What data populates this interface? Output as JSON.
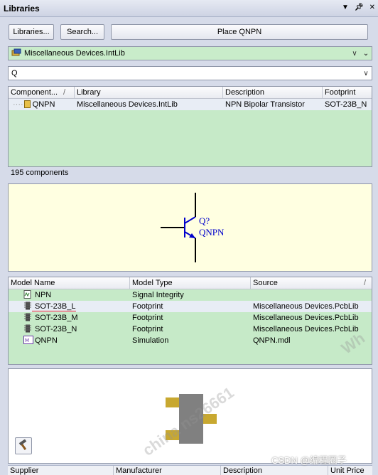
{
  "window": {
    "title": "Libraries"
  },
  "toolbar": {
    "libraries_button": "Libraries...",
    "search_button": "Search...",
    "place_button": "Place QNPN"
  },
  "library_select": {
    "value": "Miscellaneous Devices.IntLib"
  },
  "filter": {
    "value": "Q"
  },
  "components_grid": {
    "headers": [
      "Component...",
      "Library",
      "Description",
      "Footprint"
    ],
    "rows": [
      {
        "name": "QNPN",
        "library": "Miscellaneous Devices.IntLib",
        "description": "NPN Bipolar Transistor",
        "footprint": "SOT-23B_N"
      }
    ],
    "count_label": "195 components"
  },
  "schematic_preview": {
    "designator": "Q?",
    "comment": "QNPN"
  },
  "models_grid": {
    "headers": [
      "Model Name",
      "Model Type",
      "Source"
    ],
    "rows": [
      {
        "name": "NPN",
        "type": "Signal Integrity",
        "source": "",
        "icon": "signal-integrity-icon"
      },
      {
        "name": "SOT-23B_L",
        "type": "Footprint",
        "source": "Miscellaneous Devices.PcbLib",
        "icon": "footprint-icon"
      },
      {
        "name": "SOT-23B_M",
        "type": "Footprint",
        "source": "Miscellaneous Devices.PcbLib",
        "icon": "footprint-icon"
      },
      {
        "name": "SOT-23B_N",
        "type": "Footprint",
        "source": "Miscellaneous Devices.PcbLib",
        "icon": "footprint-icon"
      },
      {
        "name": "QNPN",
        "type": "Simulation",
        "source": "QNPN.mdl",
        "icon": "simulation-icon"
      }
    ]
  },
  "supplier_grid": {
    "headers": [
      "Supplier",
      "Manufacturer",
      "Description",
      "Unit Price"
    ]
  },
  "watermarks": {
    "center": "china ns26661",
    "credit": "CSDN @编程圈子",
    "side": "Wh"
  },
  "colors": {
    "grid_green": "#c6eac8",
    "schematic_bg": "#ffffe1",
    "symbol_blue": "#0000cc",
    "pad_gold": "#c8a830",
    "body_gray": "#808080"
  }
}
